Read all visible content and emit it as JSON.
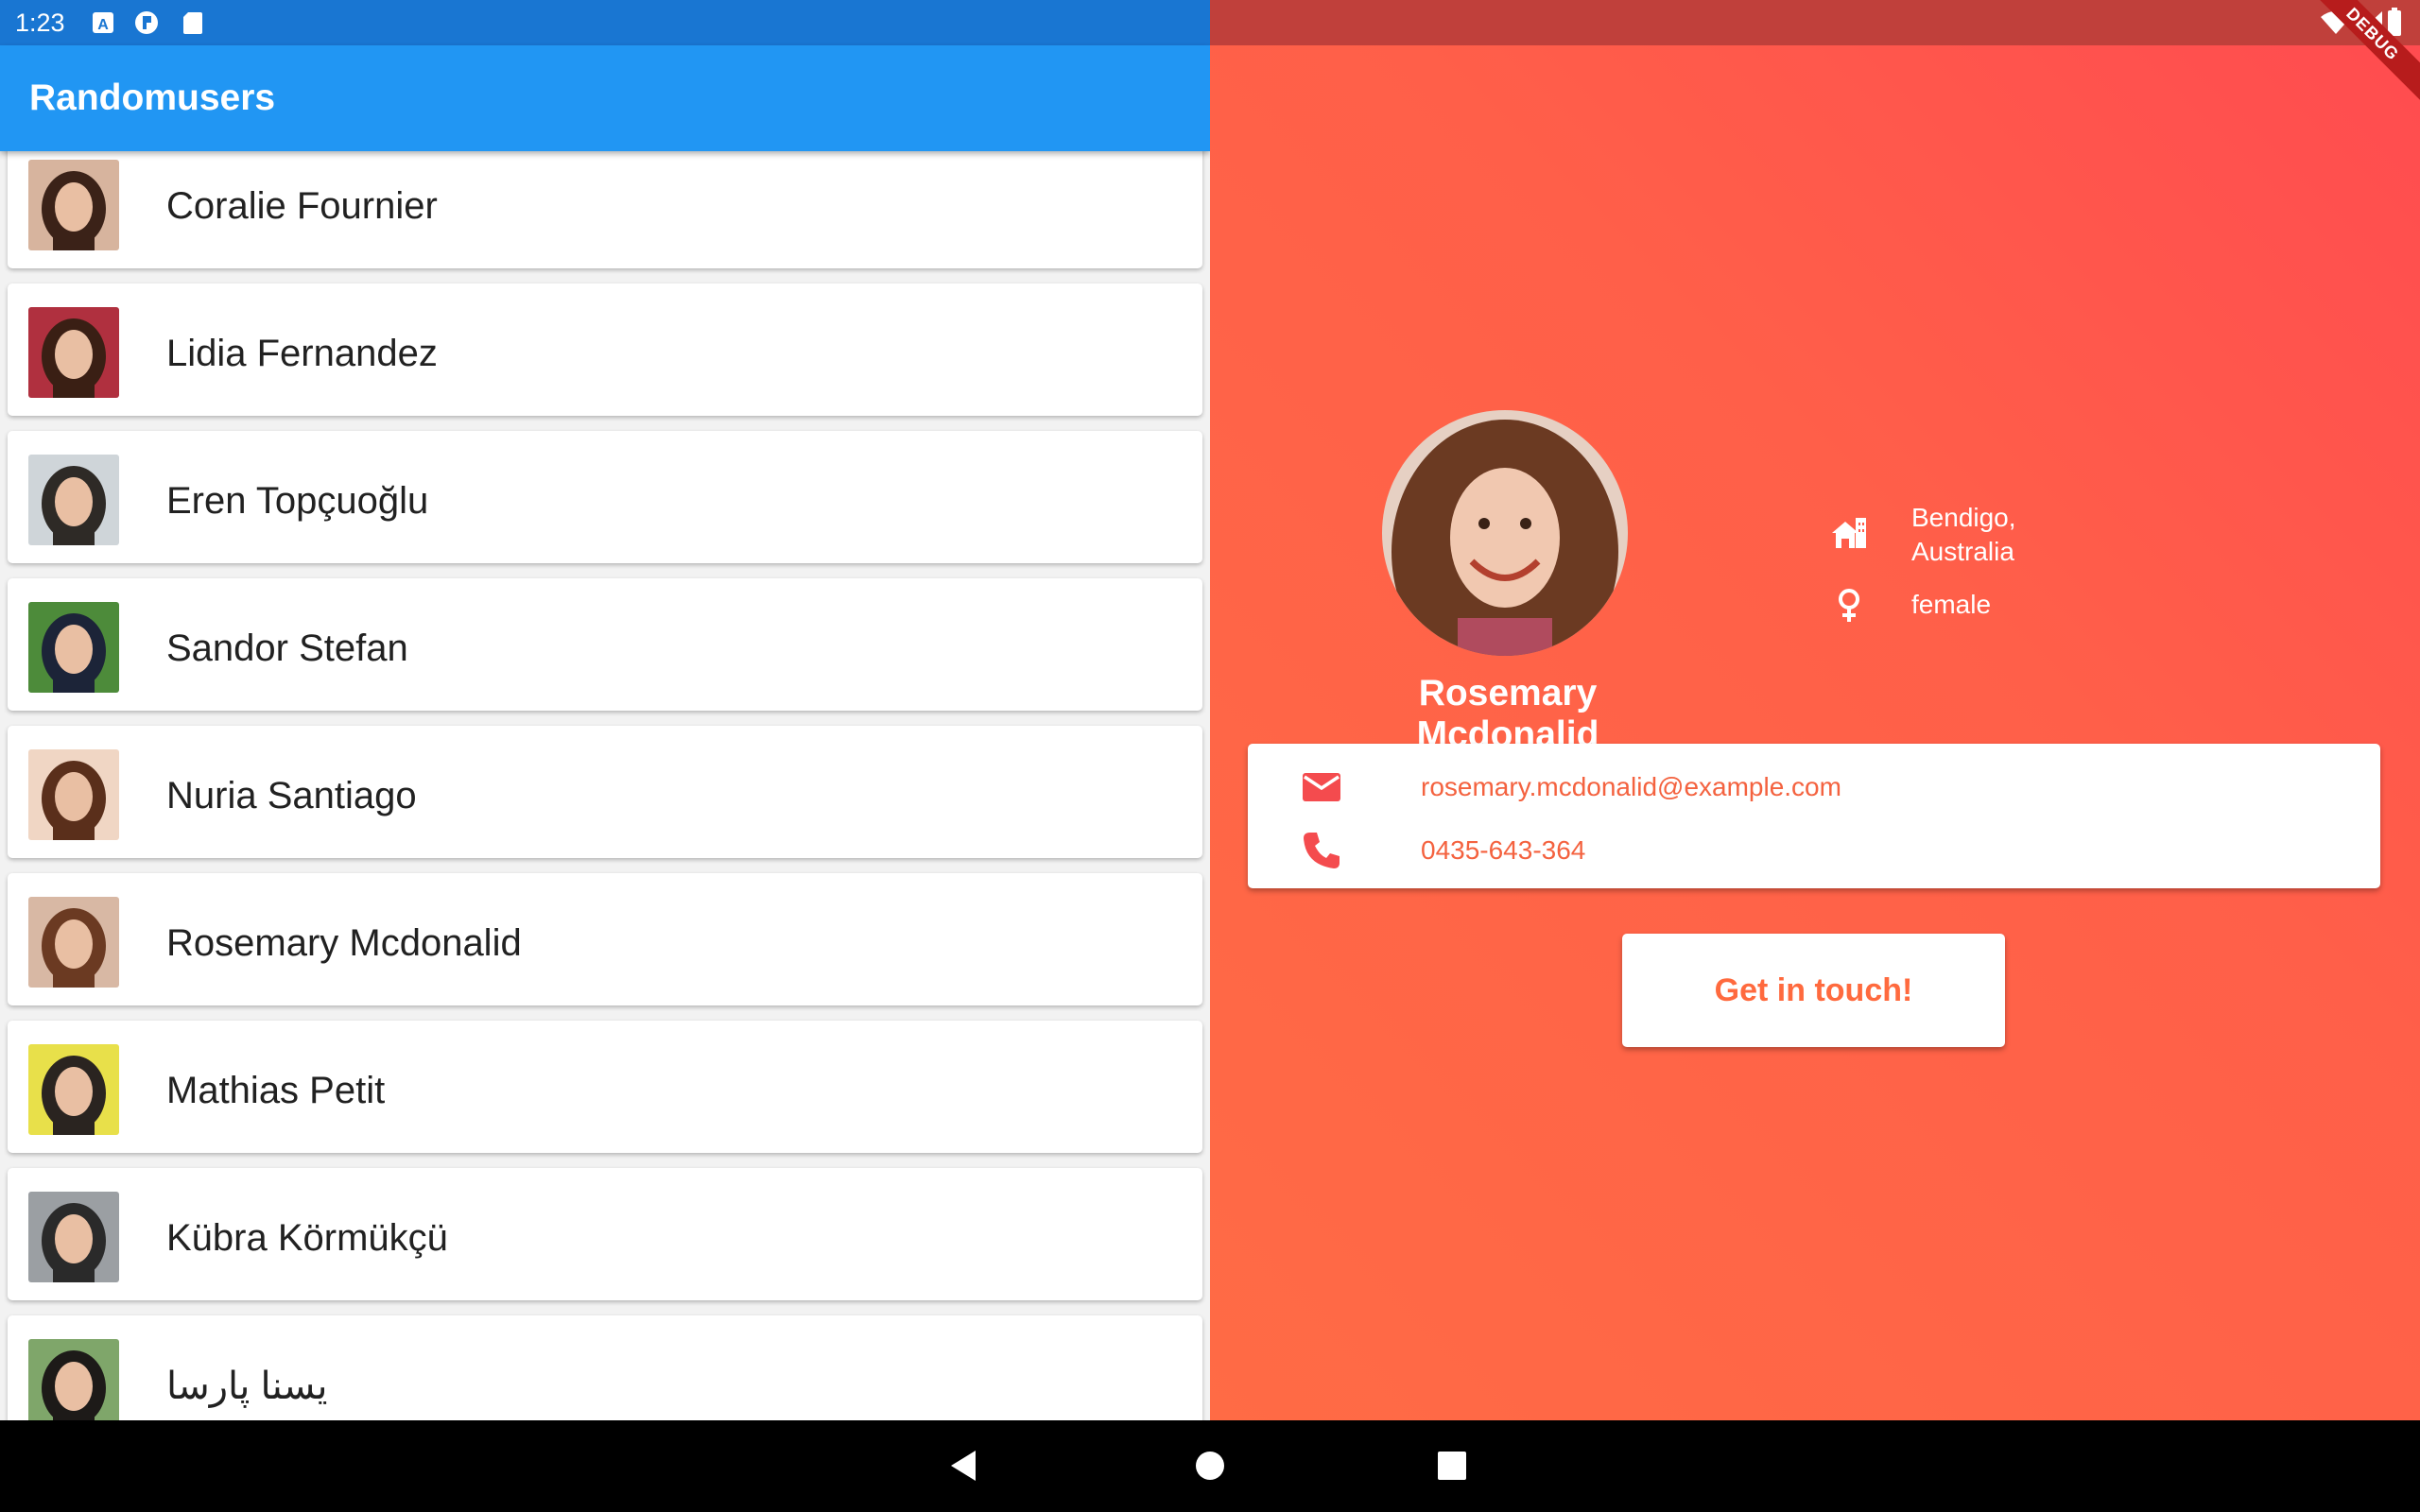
{
  "status": {
    "time": "1:23",
    "left_icons": [
      "a-notification-icon",
      "flutter-notification-icon",
      "sd-card-icon"
    ],
    "right_icons": [
      "wifi-icon",
      "signal-icon",
      "battery-icon"
    ],
    "debug_banner": "DEBUG"
  },
  "appbar": {
    "title": "Randomusers"
  },
  "users": [
    {
      "name": "Coralie Fournier",
      "avatar_colors": [
        "#d7b49e",
        "#3b2218"
      ]
    },
    {
      "name": "Lidia Fernandez",
      "avatar_colors": [
        "#b0303f",
        "#3a1f14"
      ]
    },
    {
      "name": "Eren Topçuoğlu",
      "avatar_colors": [
        "#cfd5d9",
        "#2e2a26"
      ]
    },
    {
      "name": "Sandor Stefan",
      "avatar_colors": [
        "#4d8b3a",
        "#1c2438"
      ]
    },
    {
      "name": "Nuria Santiago",
      "avatar_colors": [
        "#f0d6c4",
        "#5a2f1b"
      ]
    },
    {
      "name": "Rosemary Mcdonalid",
      "avatar_colors": [
        "#d8b8a4",
        "#6b3a22"
      ]
    },
    {
      "name": "Mathias Petit",
      "avatar_colors": [
        "#e8e04a",
        "#2a2420"
      ]
    },
    {
      "name": "Kübra Körmükçü",
      "avatar_colors": [
        "#9b9fa3",
        "#2a2a2a"
      ]
    },
    {
      "name": "یسنا پارسا",
      "avatar_colors": [
        "#7fa66a",
        "#1d1a18"
      ]
    }
  ],
  "profile": {
    "name": "Rosemary Mcdonalid",
    "location": "Bendigo, Australia",
    "gender": "female",
    "email": "rosemary.mcdonalid@example.com",
    "phone": "0435-643-364",
    "cta_label": "Get in touch!",
    "accent_color": "#ff5f49"
  },
  "navbar": {
    "buttons": [
      "back",
      "home",
      "recents"
    ]
  }
}
